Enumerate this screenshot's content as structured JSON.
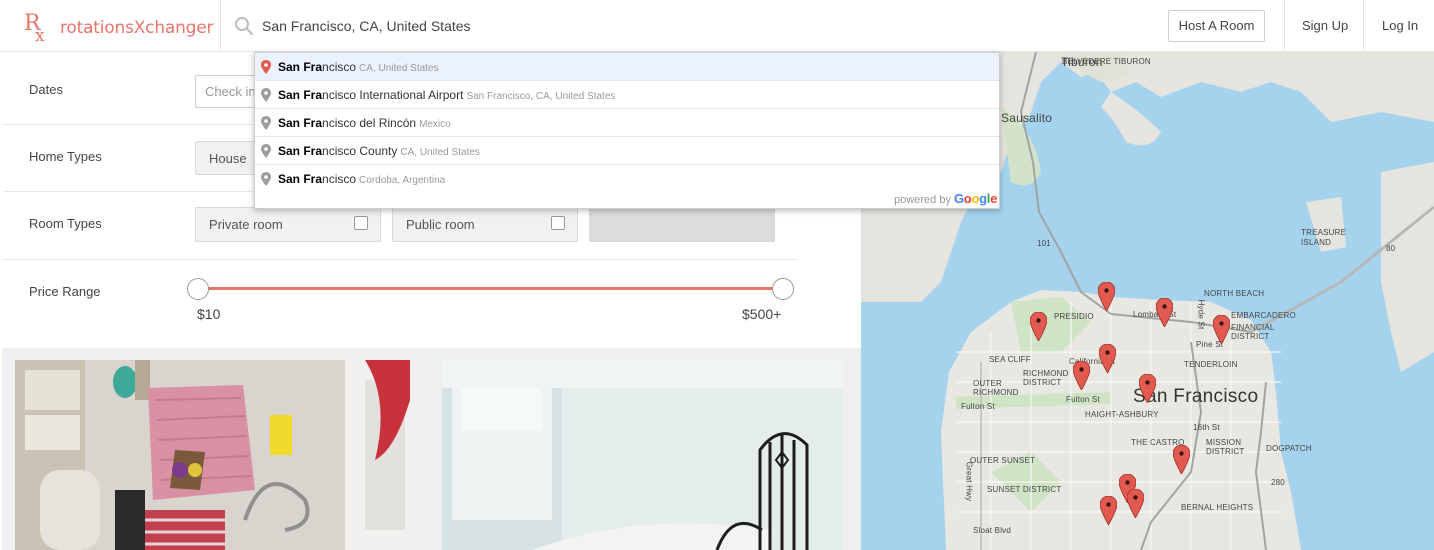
{
  "header": {
    "logo_mark": "Rx",
    "logo_text": "rotationsXchanger",
    "search_value": "San Francisco, CA, United States",
    "search_icon": "search-icon",
    "host_label": "Host A Room",
    "signup_label": "Sign Up",
    "login_label": "Log In"
  },
  "autocomplete": {
    "items": [
      {
        "match": "San Fra",
        "rest": "ncisco",
        "secondary": "CA, United States"
      },
      {
        "match": "San Fra",
        "rest": "ncisco International Airport",
        "secondary": "San Francisco, CA, United States"
      },
      {
        "match": "San Fra",
        "rest": "ncisco del Rincón",
        "secondary": "Mexico"
      },
      {
        "match": "San Fra",
        "rest": "ncisco County",
        "secondary": "CA, United States"
      },
      {
        "match": "San Fra",
        "rest": "ncisco",
        "secondary": "Cordoba, Argentina"
      }
    ],
    "powered_by": "powered by",
    "google": [
      "G",
      "o",
      "o",
      "g",
      "l",
      "e"
    ]
  },
  "filters": {
    "dates_label": "Dates",
    "checkin_placeholder": "Check in",
    "home_types_label": "Home Types",
    "home_type_option": "House",
    "room_types_label": "Room Types",
    "room_type_options": [
      "Private room",
      "Public room"
    ],
    "price_range_label": "Price Range",
    "price_min": "$10",
    "price_max": "$500+"
  },
  "map": {
    "labels": {
      "tiburon": "Tiburon",
      "belvedere": "BELVEDERE TIBURON",
      "sausalito": "Sausalito",
      "treasure": "TREASURE ISLAND",
      "north_beach": "NORTH BEACH",
      "embarcadero": "EMBARCADERO",
      "financial": "FINANCIAL DISTRICT",
      "presidio": "PRESIDIO",
      "lombard": "Lombard St",
      "hyde": "Hyde St",
      "pine": "Pine St",
      "sea_cliff": "SEA CLIFF",
      "richmond": "RICHMOND DISTRICT",
      "outer_richmond": "OUTER RICHMOND",
      "tenderloin": "TENDERLOIN",
      "california": "California St",
      "fulton": "Fulton St",
      "fulton2": "Fulton St",
      "city": "San Francisco",
      "haight": "HAIGHT-ASHBURY",
      "sixteenth": "16th St",
      "castro": "THE CASTRO",
      "mission": "MISSION DISTRICT",
      "dogpatch": "DOGPATCH",
      "outer_sunset": "OUTER SUNSET",
      "great_hwy": "Great Hwy",
      "sunset": "SUNSET DISTRICT",
      "bernal": "BERNAL HEIGHTS",
      "sloat": "Sloat Blvd",
      "hwy101": "101",
      "hwy101b": "101",
      "hwy80": "80",
      "hwy280": "280",
      "hwy280b": "280"
    },
    "colors": {
      "water": "#a5d3ee",
      "land": "#e8e6e1",
      "marker": "#e25a4f",
      "accent": "#e8756a"
    },
    "marker_count": 12
  }
}
